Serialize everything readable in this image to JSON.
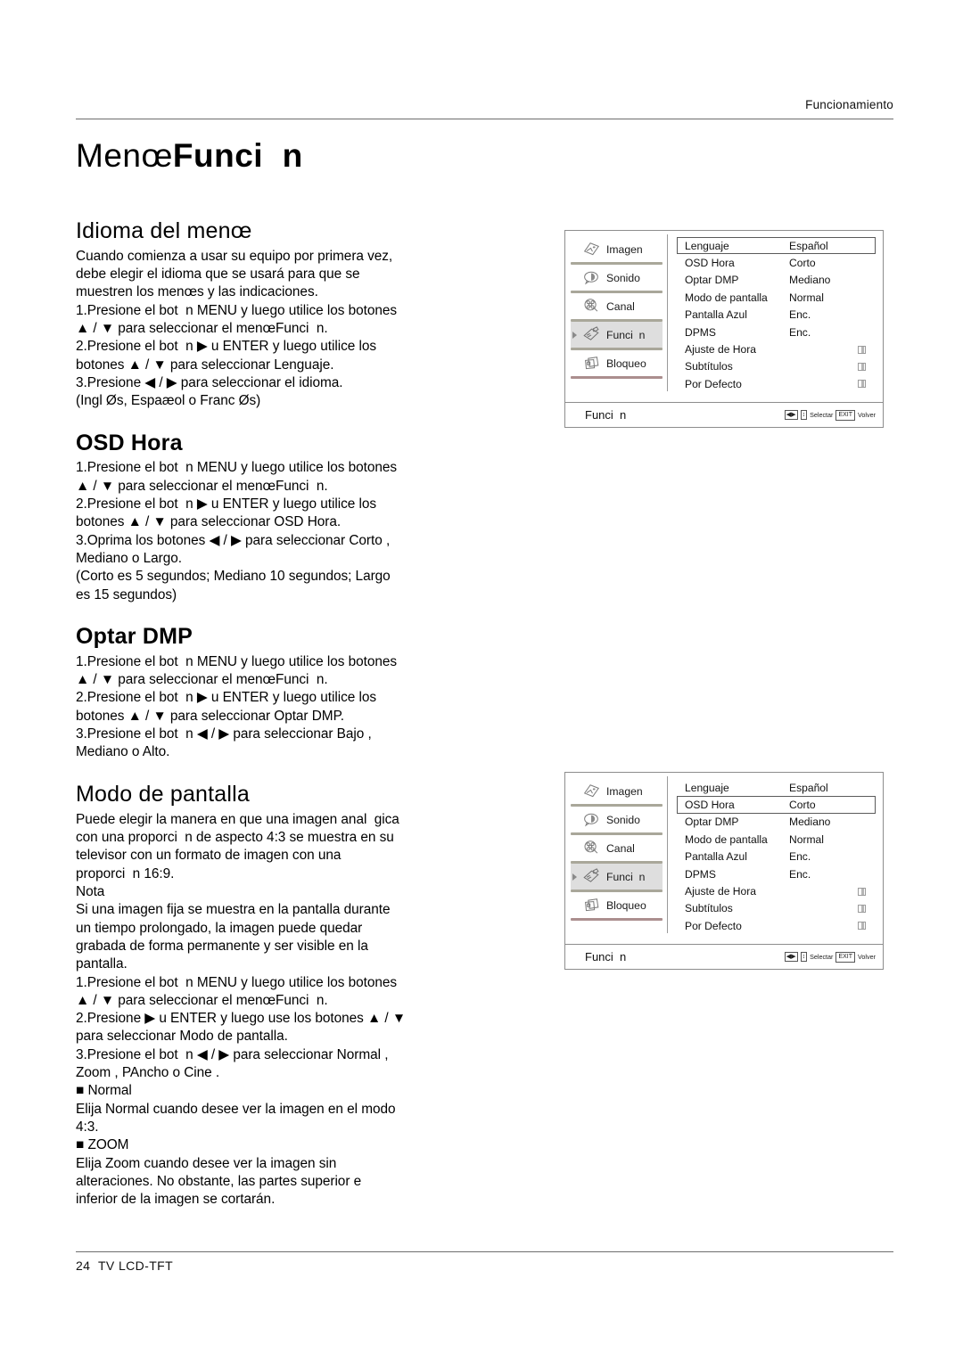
{
  "header": {
    "section_label": "Funcionamiento"
  },
  "page_title": {
    "normal": "Menœ",
    "bold": "Funci  n"
  },
  "sections": [
    {
      "id": "idioma",
      "title": "Idioma del menœ",
      "title_bold": false,
      "body": "Cuando comienza a usar su equipo por primera vez,\ndebe elegir el idioma que se usará para que se\nmuestren los menœs y las indicaciones.\n1.Presione el bot  n MENU y luego utilice los botones\n▲ / ▼ para seleccionar el menœFunci  n.\n2.Presione el bot  n ▶ u ENTER y luego utilice los\nbotones ▲ / ▼ para seleccionar Lenguaje.\n3.Presione ◀ / ▶ para seleccionar el idioma.\n(Ingl Øs, Espaæol o Franc Øs)"
    },
    {
      "id": "osd-hora",
      "title": "OSD Hora",
      "title_bold": true,
      "body": "1.Presione el bot  n MENU y luego utilice los botones\n▲ / ▼ para seleccionar el menœFunci  n.\n2.Presione el bot  n ▶ u ENTER y luego utilice los\nbotones ▲ / ▼ para seleccionar OSD Hora.\n3.Oprima los botones ◀ / ▶ para seleccionar Corto ,\nMediano o Largo.\n(Corto es 5 segundos; Mediano 10 segundos; Largo\nes 15 segundos)"
    },
    {
      "id": "optar-dmp",
      "title": "Optar DMP",
      "title_bold": true,
      "body": "1.Presione el bot  n MENU y luego utilice los botones\n▲ / ▼ para seleccionar el menœFunci  n.\n2.Presione el bot  n ▶ u ENTER y luego utilice los\nbotones ▲ / ▼ para seleccionar Optar DMP.\n3.Presione el bot  n ◀ / ▶ para seleccionar Bajo ,\nMediano o Alto."
    },
    {
      "id": "modo-pantalla",
      "title": "Modo de pantalla",
      "title_bold": false,
      "body": "Puede elegir la manera en que una imagen anal  gica\ncon una proporci  n de aspecto 4:3 se muestra en su\ntelevisor con un formato de imagen con una\nproporci  n 16:9.\nNota\nSi una imagen fija se muestra en la pantalla durante\nun tiempo prolongado, la imagen puede quedar\ngrabada de forma permanente y ser visible en la\npantalla.\n1.Presione el bot  n MENU y luego utilice los botones\n▲ / ▼ para seleccionar el menœFunci  n.\n2.Presione ▶ u ENTER y luego use los botones ▲ / ▼\npara seleccionar Modo de pantalla.\n3.Presione el bot  n ◀ / ▶ para seleccionar Normal ,\nZoom , PAncho o Cine .\n■ Normal\nElija Normal cuando desee ver la imagen en el modo\n4:3.\n■ ZOOM\nElija Zoom cuando desee ver la imagen sin\nalteraciones. No obstante, las partes superior e\ninferior de la imagen se cortarán."
    }
  ],
  "osd_menus": [
    {
      "id": "osd-menu-lenguaje",
      "selected_row": 0,
      "sidebar": [
        {
          "label": "Imagen",
          "icon": "picture-icon",
          "active": false,
          "sep": "olive"
        },
        {
          "label": "Sonido",
          "icon": "speaker-icon",
          "active": false,
          "sep": "olive"
        },
        {
          "label": "Canal",
          "icon": "film-reel-icon",
          "active": false,
          "sep": "olive"
        },
        {
          "label": "Funci  n",
          "icon": "pencil-note-icon",
          "active": true,
          "sep": "olive"
        },
        {
          "label": "Bloqueo",
          "icon": "cards-lock-icon",
          "active": false,
          "sep": "red"
        }
      ],
      "rows": [
        {
          "label": "Lenguaje",
          "value": "Español",
          "indicator": "lr-arrows"
        },
        {
          "label": "OSD Hora",
          "value": "Corto",
          "indicator": "lr-arrows"
        },
        {
          "label": "Optar DMP",
          "value": "Mediano",
          "indicator": "lr-arrows"
        },
        {
          "label": "Modo de pantalla",
          "value": "Normal",
          "indicator": "lr-arrows"
        },
        {
          "label": "Pantalla Azul",
          "value": "Enc.",
          "indicator": "lr-arrows"
        },
        {
          "label": "DPMS",
          "value": "Enc.",
          "indicator": "lr-arrows"
        },
        {
          "label": "Ajuste de Hora",
          "value": "",
          "indicator": "submenu"
        },
        {
          "label": "Subtítulos",
          "value": "",
          "indicator": "submenu"
        },
        {
          "label": "Por Defecto",
          "value": "",
          "indicator": "submenu"
        }
      ],
      "footer": {
        "title": "Funci  n",
        "select_label": "Selectar",
        "exit_key": "EXIT",
        "back_label": "Volver",
        "lr_glyph": "◀▶",
        "ud_glyph": "↕"
      }
    },
    {
      "id": "osd-menu-osd-hora",
      "selected_row": 1,
      "sidebar": [
        {
          "label": "Imagen",
          "icon": "picture-icon",
          "active": false,
          "sep": "olive"
        },
        {
          "label": "Sonido",
          "icon": "speaker-icon",
          "active": false,
          "sep": "olive"
        },
        {
          "label": "Canal",
          "icon": "film-reel-icon",
          "active": false,
          "sep": "olive"
        },
        {
          "label": "Funci  n",
          "icon": "pencil-note-icon",
          "active": true,
          "sep": "olive"
        },
        {
          "label": "Bloqueo",
          "icon": "cards-lock-icon",
          "active": false,
          "sep": "red"
        }
      ],
      "rows": [
        {
          "label": "Lenguaje",
          "value": "Español",
          "indicator": "lr-arrows"
        },
        {
          "label": "OSD Hora",
          "value": "Corto",
          "indicator": "lr-arrows"
        },
        {
          "label": "Optar DMP",
          "value": "Mediano",
          "indicator": "lr-arrows"
        },
        {
          "label": "Modo de pantalla",
          "value": "Normal",
          "indicator": "lr-arrows"
        },
        {
          "label": "Pantalla Azul",
          "value": "Enc.",
          "indicator": "lr-arrows"
        },
        {
          "label": "DPMS",
          "value": "Enc.",
          "indicator": "lr-arrows"
        },
        {
          "label": "Ajuste de Hora",
          "value": "",
          "indicator": "submenu"
        },
        {
          "label": "Subtítulos",
          "value": "",
          "indicator": "submenu"
        },
        {
          "label": "Por Defecto",
          "value": "",
          "indicator": "submenu"
        }
      ],
      "footer": {
        "title": "Funci  n",
        "select_label": "Selectar",
        "exit_key": "EXIT",
        "back_label": "Volver",
        "lr_glyph": "◀▶",
        "ud_glyph": "↕"
      }
    }
  ],
  "footer": {
    "page_number": "24",
    "product": "TV LCD-TFT"
  },
  "colors": {
    "text": "#000000",
    "rule": "#6d6d6d",
    "osd_border": "#8d8d8d",
    "sidebar_sep_olive": "#a9a79a",
    "sidebar_sep_red": "#ab8e8e",
    "sidebar_active_bg": "#dedede",
    "indicator": "#9b9b9b"
  }
}
